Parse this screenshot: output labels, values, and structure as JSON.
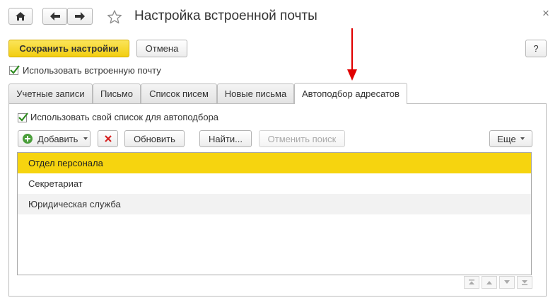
{
  "window": {
    "title": "Настройка встроенной почты",
    "close_glyph": "×"
  },
  "toolbar": {
    "save_label": "Сохранить настройки",
    "cancel_label": "Отмена",
    "help_label": "?"
  },
  "use_builtin_mail": {
    "label": "Использовать встроенную почту",
    "checked": true
  },
  "tabs": [
    {
      "label": "Учетные записи",
      "active": false
    },
    {
      "label": "Письмо",
      "active": false
    },
    {
      "label": "Список писем",
      "active": false
    },
    {
      "label": "Новые письма",
      "active": false
    },
    {
      "label": "Автоподбор адресатов",
      "active": true
    }
  ],
  "autoselect": {
    "use_own_list": {
      "label": "Использовать свой список для автоподбора",
      "checked": true
    },
    "buttons": {
      "add": "Добавить",
      "refresh": "Обновить",
      "find": "Найти...",
      "cancel_search": "Отменить поиск",
      "more": "Еще"
    },
    "rows": [
      {
        "name": "Отдел персонала",
        "selected": true
      },
      {
        "name": "Секретариат",
        "selected": false
      },
      {
        "name": "Юридическая служба",
        "selected": false
      }
    ]
  },
  "colors": {
    "accent_yellow": "#f6d40f",
    "annotation_arrow": "#e00000",
    "check_green": "#2e8b1f",
    "delete_red": "#d62020",
    "add_green": "#4a9e3a"
  },
  "icons": [
    "home-icon",
    "back-arrow-icon",
    "forward-arrow-icon",
    "star-icon",
    "close-icon",
    "checkmark-icon",
    "add-circle-icon",
    "delete-x-icon",
    "dropdown-caret-icon",
    "scroll-top-icon",
    "scroll-up-icon",
    "scroll-down-icon",
    "scroll-bottom-icon"
  ]
}
